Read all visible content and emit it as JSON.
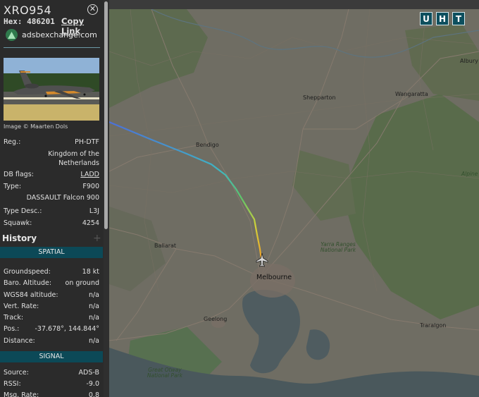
{
  "aircraft": {
    "callsign": "XRO954",
    "hex_label": "Hex:",
    "hex_value": "486201",
    "copy_link": "Copy Link",
    "site_link": "adsbexchange.com",
    "close_icon": "close-icon",
    "image_credit": "Image © Maarten Dols"
  },
  "details": {
    "reg_label": "Reg.:",
    "reg_value": "PH-DTF",
    "country_line1": "Kingdom of the",
    "country_line2": "Netherlands",
    "dbflags_label": "DB flags:",
    "dbflags_value": "LADD",
    "type_label": "Type:",
    "type_value": "F900",
    "type_full": "DASSAULT Falcon 900",
    "typedesc_label": "Type Desc.:",
    "typedesc_value": "L3J",
    "squawk_label": "Squawk:",
    "squawk_value": "4254"
  },
  "history": {
    "label": "History",
    "plus": "+"
  },
  "spatial": {
    "header": "SPATIAL",
    "rows": [
      {
        "label": "Groundspeed:",
        "value": "18 kt"
      },
      {
        "label": "Baro. Altitude:",
        "value": "on ground"
      },
      {
        "label": "WGS84 altitude:",
        "value": "n/a"
      },
      {
        "label": "Vert. Rate:",
        "value": "n/a"
      },
      {
        "label": "Track:",
        "value": "n/a"
      },
      {
        "label": "Pos.:",
        "value": "-37.678°, 144.844°"
      },
      {
        "label": "Distance:",
        "value": "n/a"
      }
    ]
  },
  "signal": {
    "header": "SIGNAL",
    "rows": [
      {
        "label": "Source:",
        "value": "ADS-B"
      },
      {
        "label": "RSSI:",
        "value": "-9.0"
      },
      {
        "label": "Msg. Rate:",
        "value": "0.8"
      }
    ]
  },
  "map_controls": {
    "u": "U",
    "h": "H",
    "t": "T"
  },
  "map_labels": {
    "albury": "Albury",
    "shepparton": "Shepparton",
    "wangaratta": "Wangaratta",
    "bendigo": "Bendigo",
    "ballarat": "Ballarat",
    "melbourne": "Melbourne",
    "geelong": "Geelong",
    "traralgon": "Traralgon",
    "yarra_ranges": "Yarra Ranges National Park",
    "great_otway": "Great Otway National Park",
    "alpine": "Alpine"
  },
  "colors": {
    "panel_bg": "#2b2b2b",
    "section_bg": "#0c4957",
    "map_land": "#6f6d63",
    "map_water": "#4d5c60",
    "forest": "#586b4a"
  }
}
